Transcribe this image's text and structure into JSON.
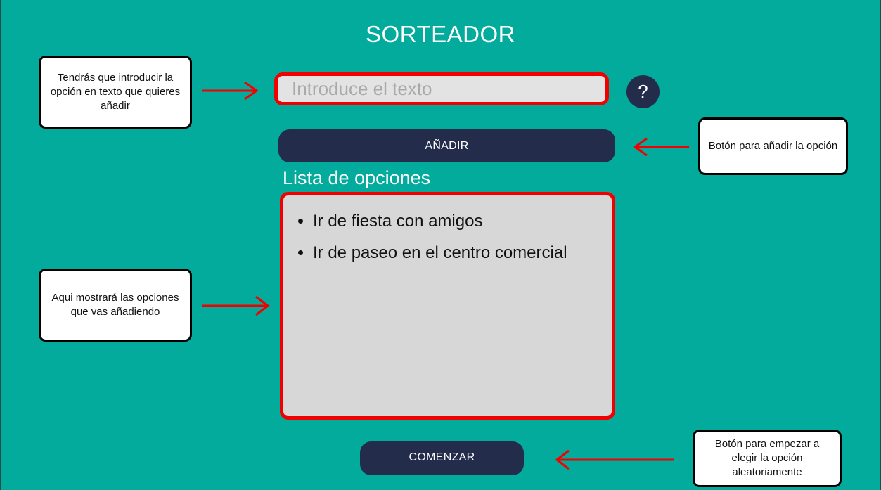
{
  "app": {
    "title": "SORTEADOR"
  },
  "input": {
    "placeholder": "Introduce el texto",
    "value": ""
  },
  "help": {
    "label": "?",
    "icon": "question-mark-icon"
  },
  "buttons": {
    "add_label": "AÑADIR",
    "start_label": "COMENZAR"
  },
  "list": {
    "title": "Lista de opciones",
    "items": [
      "Ir de fiesta con amigos",
      "Ir de paseo en el centro comercial"
    ]
  },
  "annotations": {
    "input_note": "Tendrás que introducir la opción en texto que quieres añadir",
    "add_note": "Botón para añadir la opción",
    "list_note": "Aqui mostrará las opciones que vas añadiendo",
    "start_note": "Botón para empezar a elegir la opción aleatoriamente"
  },
  "colors": {
    "background": "#02ab9c",
    "button": "#232d4b",
    "highlight": "#f20000",
    "field": "#e3e3e3",
    "list_background": "#d7d7d7"
  }
}
